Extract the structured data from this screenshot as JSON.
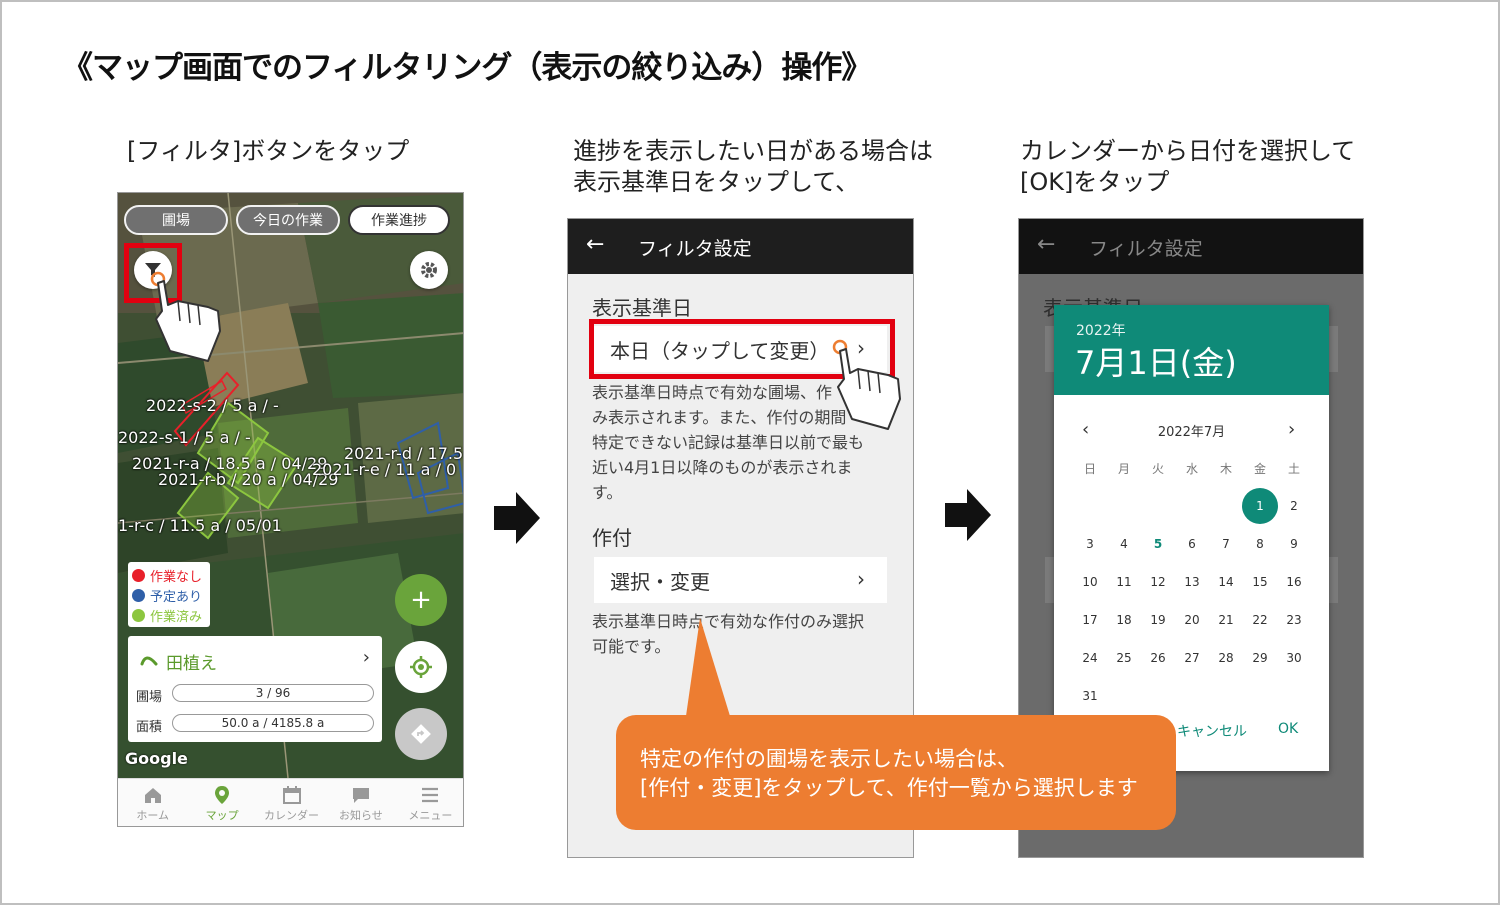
{
  "page": {
    "title": "《マップ画面でのフィルタリング（表示の絞り込み）操作》",
    "captions": {
      "step1": "[フィルタ]ボタンをタップ",
      "step2_line1": "進捗を表示したい日がある場合は",
      "step2_line2": "表示基準日をタップして、",
      "step3_line1": "カレンダーから日付を選択して",
      "step3_line2": "[OK]をタップ"
    },
    "callout_line1": "特定の作付の圃場を表示したい場合は、",
    "callout_line2": "[作付・変更]をタップして、作付一覧から選択します"
  },
  "map_screen": {
    "tabs": [
      "圃場",
      "今日の作業",
      "作業進捗"
    ],
    "active_tab": "作業進捗",
    "field_labels": [
      "2022-s-2 / 5 a / -",
      "2022-s-1 / 5 a / -",
      "2021-r-a / 18.5 a / 04/29",
      "2021-r-b / 20 a / 04/29",
      "2021-r-d / 17.5",
      "2021-r-e / 11 a / 0",
      "1-r-c / 11.5 a / 05/01"
    ],
    "legend": [
      {
        "label": "作業なし",
        "color": "#e8202a"
      },
      {
        "label": "予定あり",
        "color": "#2f5fa8"
      },
      {
        "label": "作業済み",
        "color": "#8cc63f"
      }
    ],
    "card": {
      "title": "田植え",
      "row1_label": "圃場",
      "row1_value": "3 / 96",
      "row2_label": "面積",
      "row2_value": "50.0 a / 4185.8 a"
    },
    "google": "Google",
    "nav": [
      "ホーム",
      "マップ",
      "カレンダー",
      "お知らせ",
      "メニュー"
    ],
    "active_nav": "マップ",
    "icons": [
      "filter-icon",
      "gear-icon",
      "plus-icon",
      "locate-icon",
      "direction-icon"
    ]
  },
  "filter_screen": {
    "title": "フィルタ設定",
    "date_section": "表示基準日",
    "date_value": "本日（タップして変更）",
    "date_help": [
      "表示基準日時点で有効な圃場、作",
      "み表示されます。また、作付の期間",
      "特定できない記録は基準日以前で最も",
      "近い4月1日以降のものが表示されま",
      "す。"
    ],
    "crop_section": "作付",
    "crop_value": "選択・変更",
    "crop_help": [
      "表示基準日時点で有効な作付のみ選択",
      "可能です。"
    ]
  },
  "calendar_screen": {
    "title": "フィルタ設定",
    "bg_section": "表示基準日",
    "year": "2022年",
    "selected_date": "7月1日(金)",
    "month_label": "2022年7月",
    "weekdays": [
      "日",
      "月",
      "火",
      "水",
      "木",
      "金",
      "土"
    ],
    "selected_day": 1,
    "highlight_day": 5,
    "cancel": "キャンセル",
    "ok": "OK"
  }
}
